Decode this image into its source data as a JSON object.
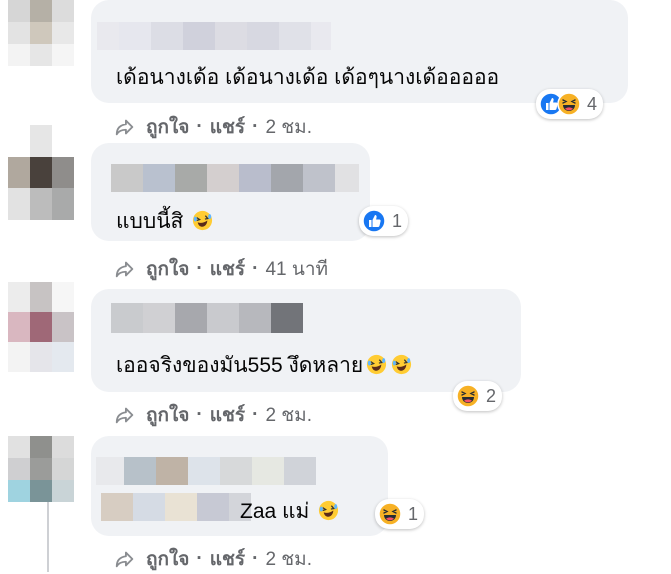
{
  "comments": [
    {
      "text": "เด้อนางเด้อ เด้อนางเด้อ เด้อๆนางเด้อออออ",
      "reaction_count": "4",
      "actions": {
        "like": "ถูกใจ",
        "share": "แชร์",
        "dot": "·",
        "time": "2 ชม."
      }
    },
    {
      "text": "แบบนี้สิ",
      "reaction_count": "1",
      "actions": {
        "like": "ถูกใจ",
        "share": "แชร์",
        "dot": "·",
        "time": "41 นาที"
      }
    },
    {
      "text": "เออจริงของมัน555 งึดหลาย",
      "reaction_count": "2",
      "actions": {
        "like": "ถูกใจ",
        "share": "แชร์",
        "dot": "·",
        "time": "2 ชม."
      }
    },
    {
      "text": "Zaa แม่",
      "reaction_count": "1",
      "actions": {
        "like": "ถูกใจ",
        "share": "แชร์",
        "dot": "·",
        "time": "2 ชม."
      }
    }
  ],
  "colors": {
    "bubble": "#f0f2f5",
    "meta_text": "#65676b",
    "like_blue": "#1877f2",
    "haha_yellow": "#f7b125"
  },
  "icons": [
    "share-icon",
    "like-reaction-icon",
    "haha-reaction-icon",
    "laughing-emoji-icon"
  ]
}
